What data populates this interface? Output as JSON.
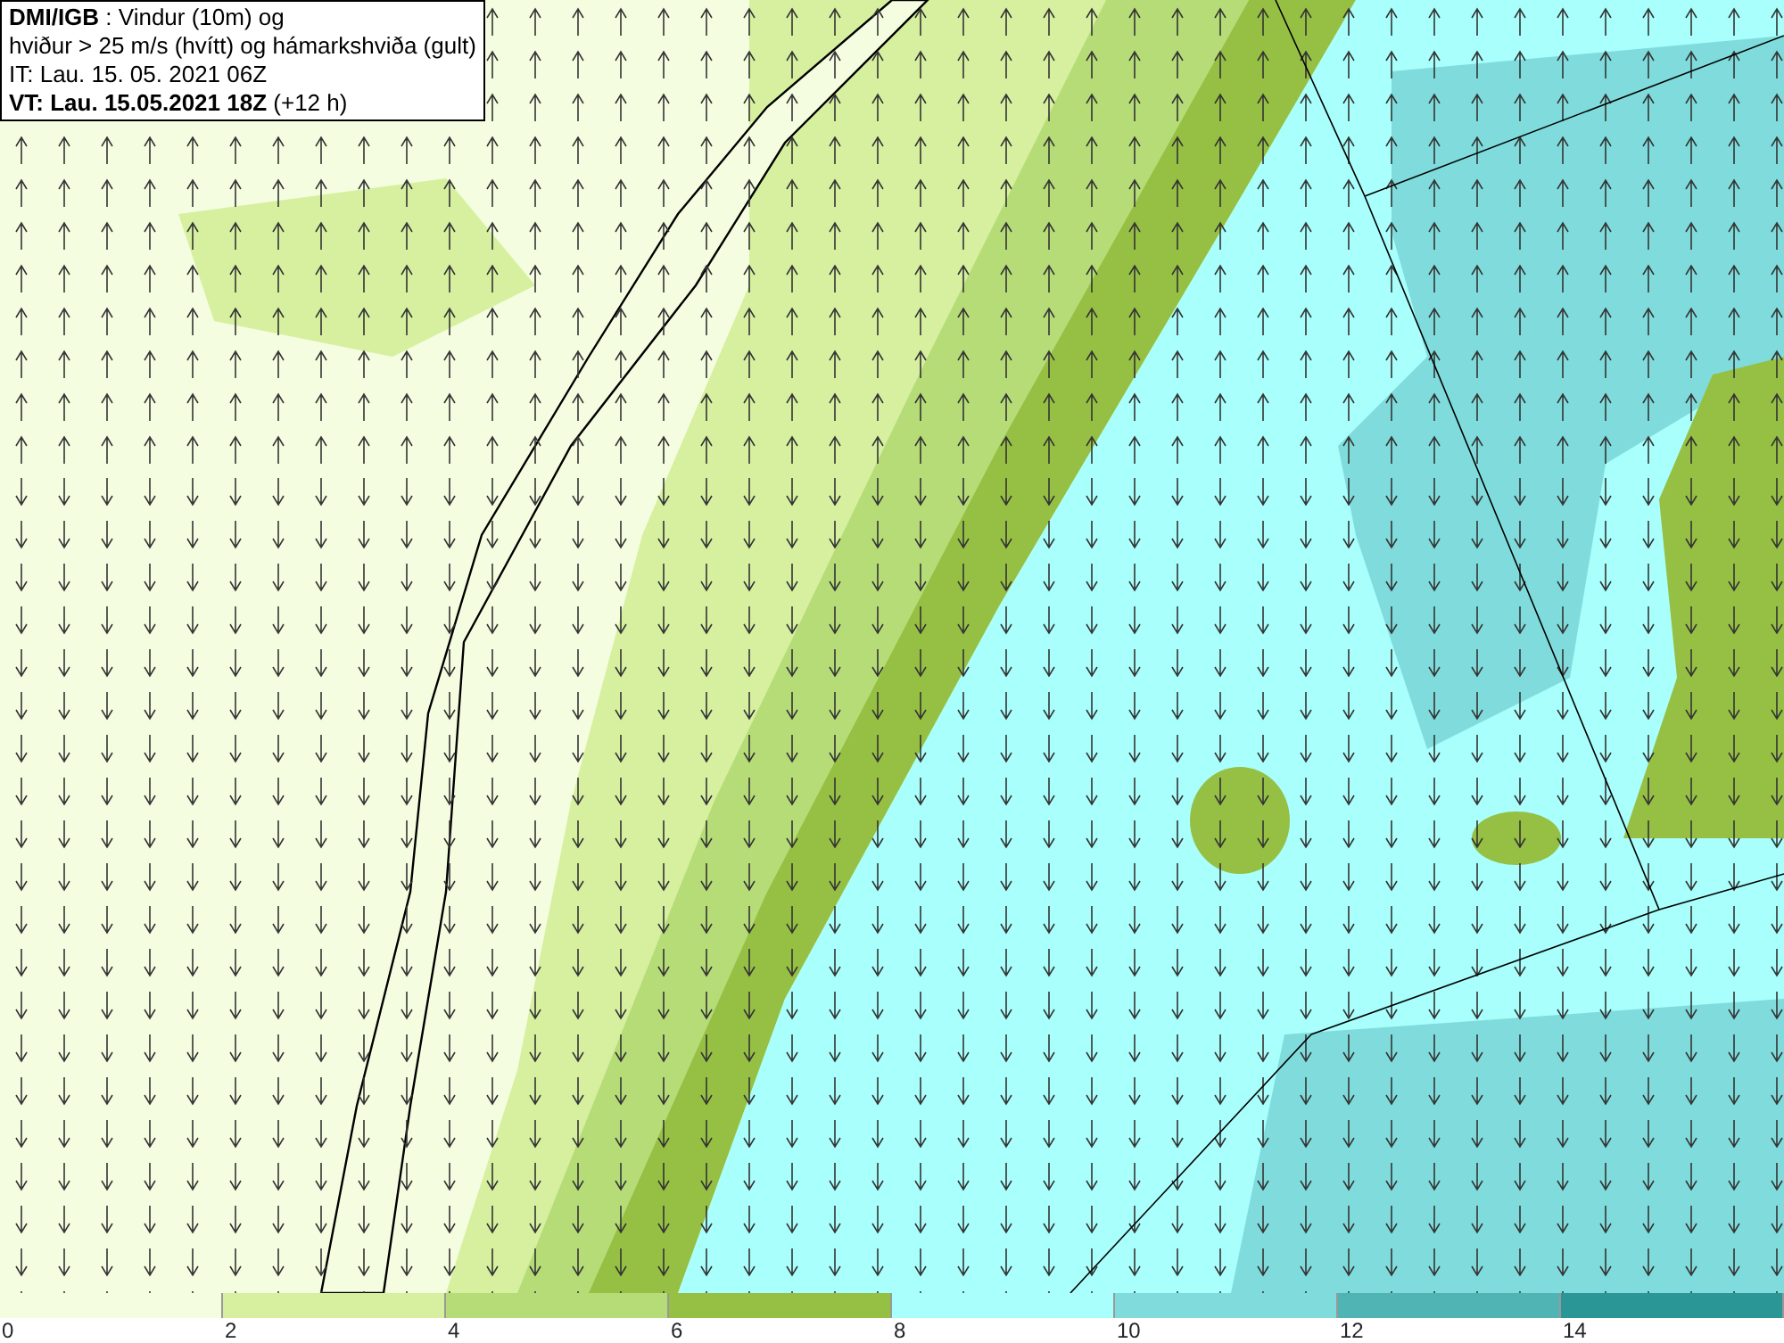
{
  "info_box": {
    "lines": [
      "**DMI/IGB** : Vindur (10m) og",
      "hviður > 25 m/s (hvítt) og hámarkshviða (gult)",
      "IT: Lau. 15. 05. 2021 06Z",
      "**VT: Lau. 15.05.2021 18Z** (+12 h)"
    ]
  },
  "legend": {
    "bins": [
      {
        "label": "0",
        "color": "#f5fde0"
      },
      {
        "label": "2",
        "color": "#d6f0a0"
      },
      {
        "label": "4",
        "color": "#b6dc78"
      },
      {
        "label": "6",
        "color": "#96c044"
      },
      {
        "label": "8",
        "color": "#a8fffc"
      },
      {
        "label": "10",
        "color": "#80dcdc"
      },
      {
        "label": "12",
        "color": "#50b4b4"
      },
      {
        "label": "14",
        "color": "#2a9696"
      }
    ]
  }
}
